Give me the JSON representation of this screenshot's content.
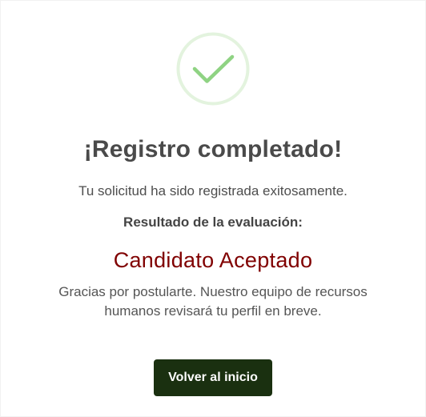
{
  "status": {
    "icon": "check-circle-icon",
    "accent_color": "#8fd383",
    "ring_color": "#e3f3de"
  },
  "header": {
    "title": "¡Registro completado!",
    "subtitle": "Tu solicitud ha sido registrada exitosamente."
  },
  "evaluation": {
    "label": "Resultado de la evaluación:",
    "result": "Candidato Aceptado",
    "result_color": "#800000"
  },
  "message": "Gracias por postularte. Nuestro equipo de recursos humanos revisará tu perfil en breve.",
  "actions": {
    "home_label": "Volver al inicio",
    "button_color": "#1a3010"
  }
}
